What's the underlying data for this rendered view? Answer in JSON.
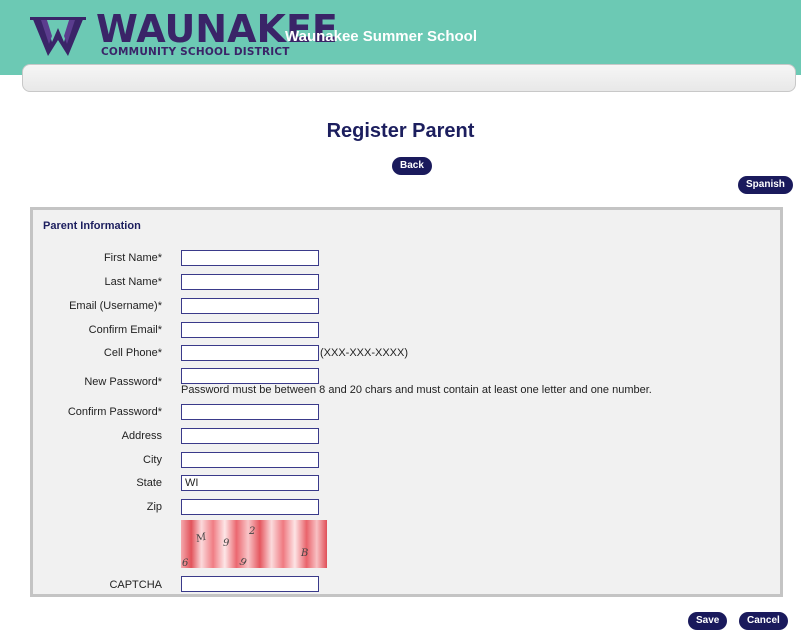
{
  "header": {
    "logo_text": "WAUNAKEE",
    "logo_subtext": "COMMUNITY SCHOOL DISTRICT",
    "app_title": "Waunakee Summer School"
  },
  "page": {
    "title": "Register Parent",
    "back_label": "Back",
    "language_label": "Spanish"
  },
  "form": {
    "section_title": "Parent Information",
    "fields": {
      "first_name": {
        "label": "First Name*",
        "value": ""
      },
      "last_name": {
        "label": "Last Name*",
        "value": ""
      },
      "email": {
        "label": "Email (Username)*",
        "value": ""
      },
      "confirm_email": {
        "label": "Confirm Email*",
        "value": ""
      },
      "cell_phone": {
        "label": "Cell Phone*",
        "value": "",
        "hint": "(XXX-XXX-XXXX)"
      },
      "new_password": {
        "label": "New Password*",
        "value": "",
        "hint": "Password must be between 8 and 20 chars and must contain at least one letter and one number."
      },
      "confirm_password": {
        "label": "Confirm Password*",
        "value": ""
      },
      "address": {
        "label": "Address",
        "value": ""
      },
      "city": {
        "label": "City",
        "value": ""
      },
      "state": {
        "label": "State",
        "value": "WI"
      },
      "zip": {
        "label": "Zip",
        "value": ""
      },
      "captcha": {
        "label": "CAPTCHA",
        "value": "",
        "image_chars": [
          "M",
          "9",
          "2",
          "B",
          "6",
          "9"
        ]
      }
    }
  },
  "actions": {
    "save_label": "Save",
    "cancel_label": "Cancel"
  },
  "colors": {
    "header_bg": "#6cc9b4",
    "brand_purple": "#3a2468",
    "button_navy": "#1a1a5c",
    "title_navy": "#1c1e5e"
  }
}
